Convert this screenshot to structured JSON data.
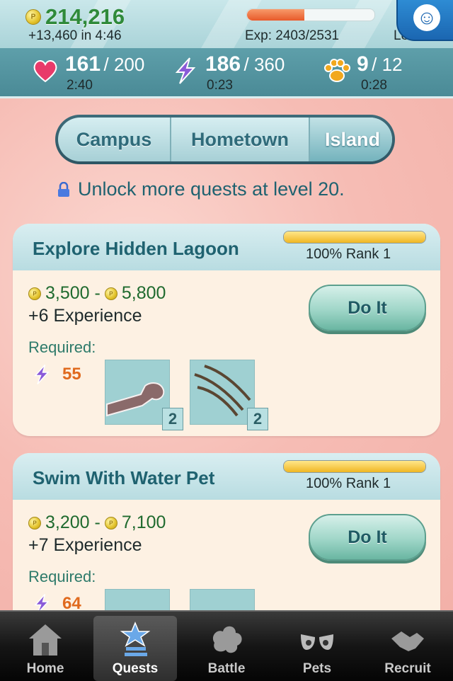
{
  "header": {
    "coins": "214,216",
    "coin_rate": "+13,460 in 4:46",
    "exp_text": "Exp: 2403/2531",
    "exp_progress": 0.45,
    "level_text": "Level"
  },
  "stats": {
    "health": {
      "value": "161",
      "max": "/ 200",
      "timer": "2:40"
    },
    "energy": {
      "value": "186",
      "max": "/ 360",
      "timer": "0:23"
    },
    "pets": {
      "value": "9",
      "max": "/ 12",
      "timer": "0:28"
    }
  },
  "location_tabs": [
    {
      "label": "Campus",
      "active": false
    },
    {
      "label": "Hometown",
      "active": false
    },
    {
      "label": "Island",
      "active": true
    }
  ],
  "unlock_message": "Unlock more quests at level 20.",
  "quests": [
    {
      "title": "Explore Hidden Lagoon",
      "rank_progress": 1.0,
      "rank_text": "100% Rank 1",
      "reward_min": "3,500 -",
      "reward_max": "5,800",
      "experience": "+6 Experience",
      "required_label": "Required:",
      "energy_required": "55",
      "items": [
        {
          "name": "arm-item",
          "count": "2"
        },
        {
          "name": "claw-item",
          "count": "2"
        }
      ],
      "button_label": "Do It"
    },
    {
      "title": "Swim With Water Pet",
      "rank_progress": 1.0,
      "rank_text": "100% Rank 1",
      "reward_min": "3,200 -",
      "reward_max": "7,100",
      "experience": "+7 Experience",
      "required_label": "Required:",
      "energy_required": "64",
      "button_label": "Do It"
    }
  ],
  "tabbar": [
    {
      "label": "Home",
      "icon": "home-icon"
    },
    {
      "label": "Quests",
      "icon": "quests-icon",
      "active": true
    },
    {
      "label": "Battle",
      "icon": "battle-icon"
    },
    {
      "label": "Pets",
      "icon": "pets-icon"
    },
    {
      "label": "Recruit",
      "icon": "recruit-icon"
    }
  ],
  "colors": {
    "money_green": "#2f8a3a",
    "teal_text": "#1f6270",
    "energy_orange": "#e06a1e",
    "exp_bar": "#e85a2a",
    "rank_bar": "#f0b623"
  }
}
